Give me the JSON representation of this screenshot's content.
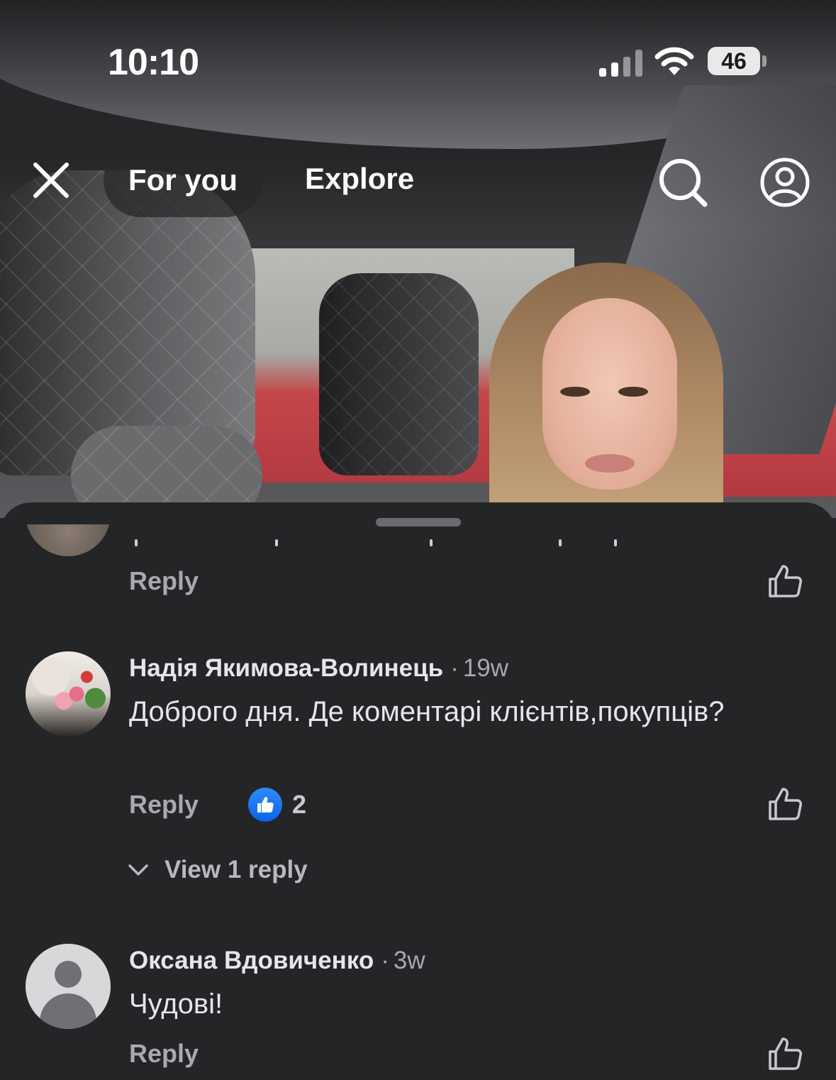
{
  "status_bar": {
    "time": "10:10",
    "battery": "46",
    "icons": [
      "signal-icon",
      "wifi-icon",
      "battery-icon"
    ]
  },
  "nav": {
    "tabs": [
      {
        "label": "For you",
        "active": true
      },
      {
        "label": "Explore",
        "active": false
      }
    ],
    "icons": [
      "close-icon",
      "search-icon",
      "profile-icon"
    ]
  },
  "comments": {
    "partial": {
      "reply_label": "Reply"
    },
    "items": [
      {
        "author": "Надія Якимова-Волинець",
        "separator": "·",
        "time": "19w",
        "text": "Доброго дня. Де коментарі клієнтів,покупців?",
        "reply_label": "Reply",
        "reaction_count": "2",
        "view_replies_label": "View 1 reply"
      },
      {
        "author": "Оксана Вдовиченко",
        "separator": "·",
        "time": "3w",
        "text": "Чудові!",
        "reply_label": "Reply"
      }
    ]
  },
  "colors": {
    "sheet_background": "#242526",
    "reaction_blue": "#0a63e8",
    "secondary_text": "#a8a9ad"
  }
}
